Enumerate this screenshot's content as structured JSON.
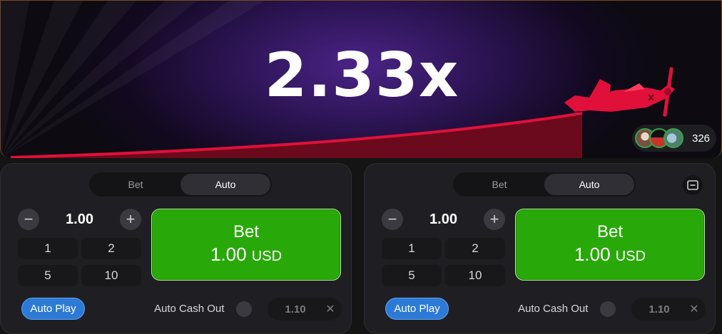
{
  "game": {
    "multiplier": "2.33x",
    "player_count": "326",
    "avatars": [
      "avatar-1",
      "avatar-2",
      "avatar-3"
    ],
    "colors": {
      "curve": "#e0103a",
      "plane": "#e0103a",
      "background": "#2a1350"
    }
  },
  "panels": [
    {
      "tabs": [
        "Bet",
        "Auto"
      ],
      "active_tab": "Auto",
      "amount": "1.00",
      "quick_amounts": [
        "1",
        "2",
        "5",
        "10"
      ],
      "bet_button": {
        "label": "Bet",
        "amount": "1.00",
        "currency": "USD"
      },
      "auto_play_label": "Auto Play",
      "auto_cash_out_label": "Auto Cash Out",
      "auto_cash_out_value": "1.10",
      "clear_icon": "✕"
    },
    {
      "tabs": [
        "Bet",
        "Auto"
      ],
      "active_tab": "Auto",
      "amount": "1.00",
      "quick_amounts": [
        "1",
        "2",
        "5",
        "10"
      ],
      "bet_button": {
        "label": "Bet",
        "amount": "1.00",
        "currency": "USD"
      },
      "auto_play_label": "Auto Play",
      "auto_cash_out_label": "Auto Cash Out",
      "auto_cash_out_value": "1.10",
      "clear_icon": "✕"
    }
  ],
  "icons": {
    "minus": "−",
    "plus": "+",
    "collapse": "minus-square-icon"
  }
}
